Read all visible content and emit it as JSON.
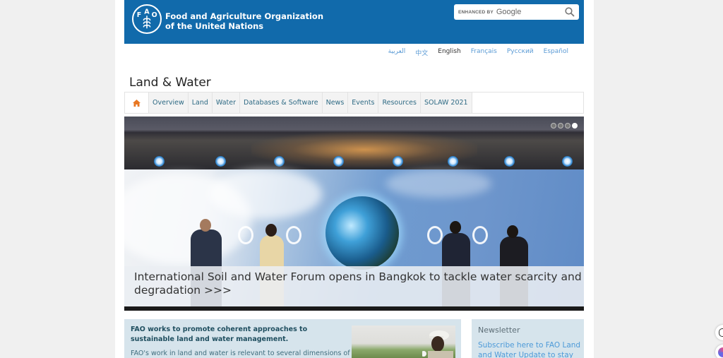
{
  "header": {
    "org_name_line1": "Food and Agriculture Organization",
    "org_name_line2": "of the United Nations",
    "logo_letters": "FAO",
    "search": {
      "enhanced_by": "ENHANCED BY",
      "provider": "Google",
      "placeholder": ""
    }
  },
  "languages": [
    {
      "label": "العربية",
      "active": false
    },
    {
      "label": "中文",
      "active": false
    },
    {
      "label": "English",
      "active": true
    },
    {
      "label": "Français",
      "active": false
    },
    {
      "label": "Русский",
      "active": false
    },
    {
      "label": "Español",
      "active": false
    }
  ],
  "section_title": "Land & Water",
  "nav": {
    "home_icon": "home-icon",
    "items": [
      "Overview",
      "Land",
      "Water",
      "Databases & Software",
      "News",
      "Events",
      "Resources",
      "SOLAW 2021"
    ]
  },
  "slider": {
    "caption_line1": "International Soil and Water Forum opens in Bangkok to tackle water scarcity and soil",
    "caption_line2": "degradation >>>",
    "dot_count": 4,
    "active_dot": 4
  },
  "intro": {
    "headline": "FAO works to promote coherent approaches to sustainable land and water management.",
    "body": "FAO's work in land and water is relevant to several dimensions of"
  },
  "newsletter": {
    "title": "Newsletter",
    "link": "Subscribe here to FAO Land and Water Update to stay"
  },
  "colors": {
    "header_blue": "#116aab",
    "home_icon_orange": "#e87722",
    "nav_text": "#2e6a84",
    "panel_bg": "#d6e4ec",
    "link_blue": "#4d9ad8"
  }
}
